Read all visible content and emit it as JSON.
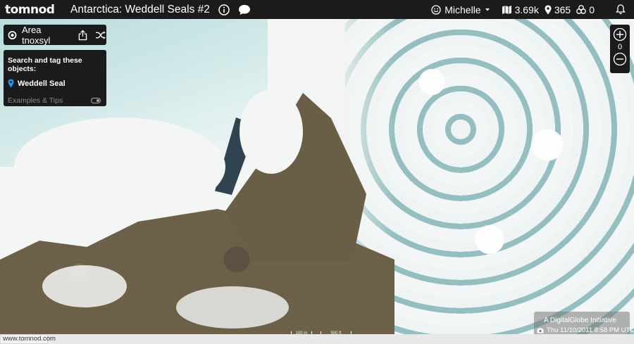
{
  "header": {
    "logo": "tomnod",
    "title": "Antarctica: Weddell Seals #2",
    "user_name": "Michelle",
    "stat_area": "3.69k",
    "stat_tags": "365",
    "stat_third": "0"
  },
  "area_panel": {
    "name": "Area tnoxsyl"
  },
  "search_panel": {
    "heading": "Search and tag these objects:",
    "objects": [
      {
        "label": "Weddell Seal",
        "color": "#2196f3"
      }
    ],
    "examples_label": "Examples & Tips"
  },
  "zoom": {
    "level": "0"
  },
  "attribution": {
    "line1": "A DigitalGlobe  Initiative",
    "line2": "Thu 11/10/2011 8:58 PM UTC"
  },
  "scale": {
    "left_label": "100 m",
    "right_label": "500 ft"
  },
  "status_bar": {
    "url": "www.tomnod.com"
  }
}
